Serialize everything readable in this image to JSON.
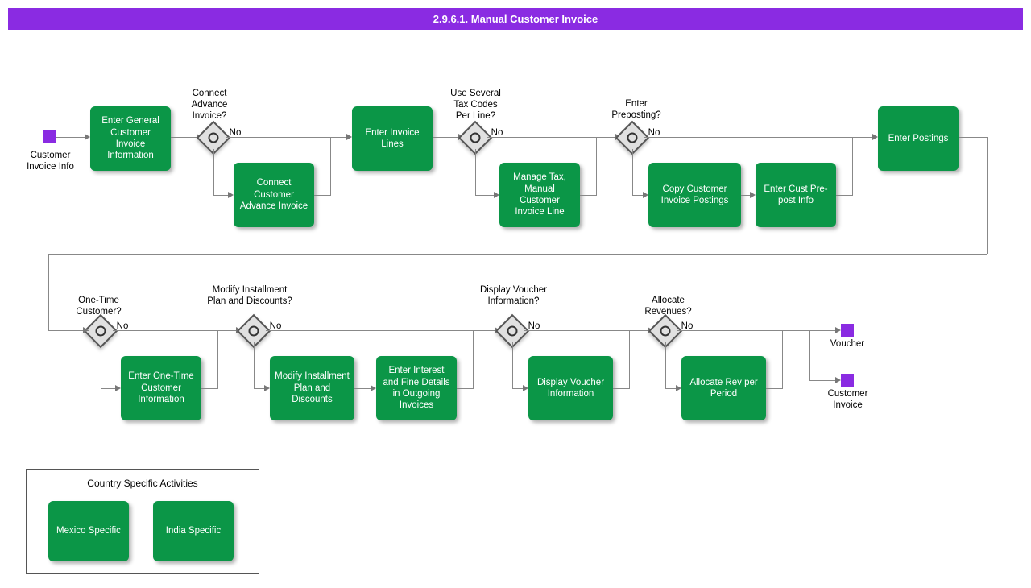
{
  "header": {
    "title": "2.9.6.1. Manual Customer Invoice"
  },
  "events": {
    "start": "Customer Invoice Info",
    "voucher": "Voucher",
    "customer_invoice": "Customer Invoice"
  },
  "gateways": {
    "g1": {
      "label": "Connect Advance Invoice?",
      "no": "No"
    },
    "g2": {
      "label": "Use Several Tax Codes Per Line?",
      "no": "No"
    },
    "g3": {
      "label": "Enter Preposting?",
      "no": "No"
    },
    "g4": {
      "label": "One-Time Customer?",
      "no": "No"
    },
    "g5": {
      "label": "Modify Installment Plan and Discounts?",
      "no": "No"
    },
    "g6": {
      "label": "Display Voucher Information?",
      "no": "No"
    },
    "g7": {
      "label": "Allocate Revenues?",
      "no": "No"
    }
  },
  "activities": {
    "a1": "Enter General Customer Invoice Information",
    "a2": "Connect Customer Advance Invoice",
    "a3": "Enter Invoice Lines",
    "a4": "Manage Tax, Manual Customer Invoice Line",
    "a5": "Copy Customer Invoice Postings",
    "a6": "Enter Cust Pre-post Info",
    "a7": "Enter Postings",
    "a8": "Enter One-Time Customer Information",
    "a9": "Modify Installment Plan and Discounts",
    "a10": "Enter Interest and Fine Details in Outgoing Invoices",
    "a11": "Display Voucher Information",
    "a12": "Allocate Rev per Period",
    "mexico": "Mexico Specific",
    "india": "India Specific"
  },
  "group": {
    "title": "Country Specific Activities"
  }
}
